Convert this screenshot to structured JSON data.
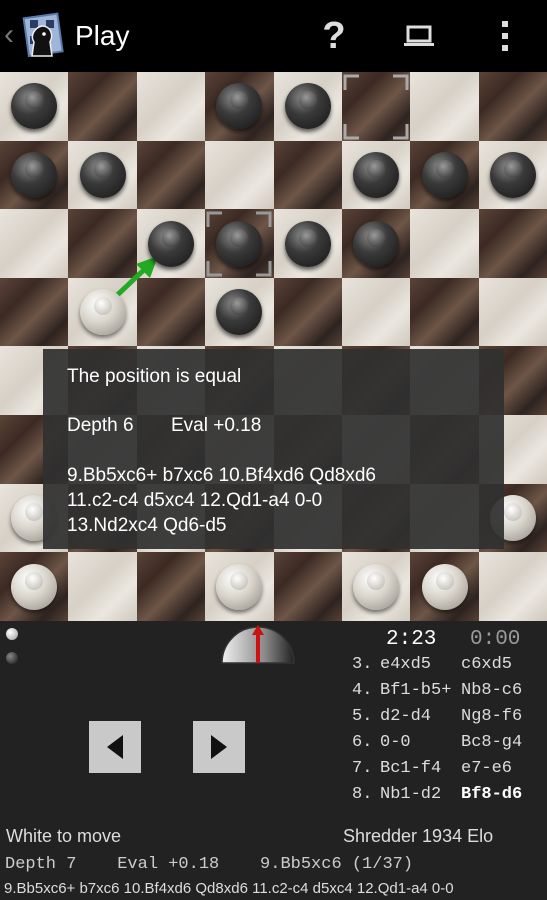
{
  "actionbar": {
    "back_glyph": "‹",
    "title": "Play",
    "help_icon": "?"
  },
  "eval_popup": {
    "line1": "The position is equal",
    "depth": "Depth 6",
    "eval": "Eval +0.18",
    "pv1": "9.Bb5xc6+ b7xc6  10.Bf4xd6 Qd8xd6",
    "pv2": "11.c2-c4 d5xc4  12.Qd1-a4 0-0",
    "pv3": "13.Nd2xc4 Qd6-d5"
  },
  "clocks": {
    "white": "2:23",
    "black": "0:00"
  },
  "moves": [
    {
      "num": "3.",
      "white": "e4xd5",
      "black": "c6xd5"
    },
    {
      "num": "4.",
      "white": "Bf1-b5+",
      "black": "Nb8-c6"
    },
    {
      "num": "5.",
      "white": "d2-d4",
      "black": "Ng8-f6"
    },
    {
      "num": "6.",
      "white": "0-0",
      "black": "Bc8-g4"
    },
    {
      "num": "7.",
      "white": "Bc1-f4",
      "black": "e7-e6"
    },
    {
      "num": "8.",
      "white": "Nb1-d2",
      "black": "Bf8-d6"
    }
  ],
  "status": {
    "to_move": "White to move",
    "engine_name": "Shredder 1934 Elo",
    "engine_line": "Depth 7    Eval +0.18    9.Bb5xc6 (1/37)",
    "pv_line": "9.Bb5xc6+ b7xc6  10.Bf4xd6 Qd8xd6  11.c2-c4 d5xc4  12.Qd1-a4 0-0"
  },
  "icons": {
    "back": "chevron-left-icon",
    "logo": "app-logo-icon",
    "help": "help-icon",
    "device": "laptop-icon",
    "overflow": "overflow-menu-icon",
    "prev": "previous-move-icon",
    "next": "next-move-icon",
    "white_dot": "white-player-icon",
    "black_dot": "black-player-icon",
    "gauge": "strength-gauge-icon"
  },
  "colors": {
    "move_arrow": "#22aa22",
    "gauge_needle": "#cc1111",
    "light_square": "#e2ddd5",
    "dark_square": "#4a362d"
  }
}
